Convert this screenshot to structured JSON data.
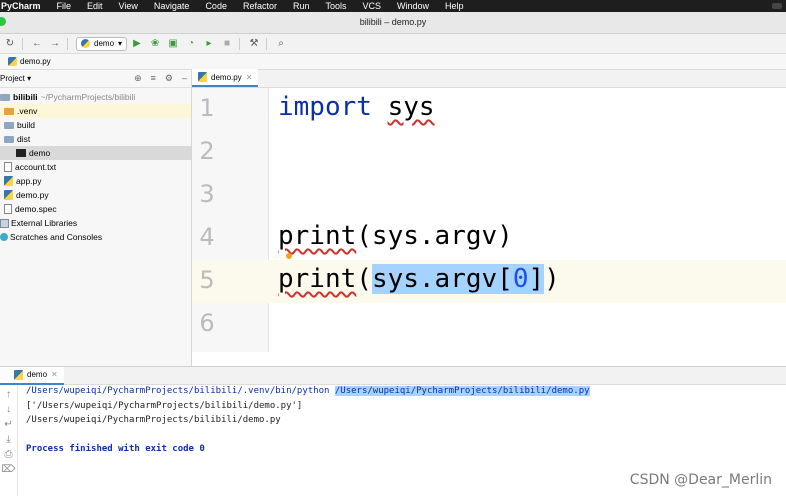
{
  "menubar": {
    "app": "PyCharm",
    "items": [
      "File",
      "Edit",
      "View",
      "Navigate",
      "Code",
      "Refactor",
      "Run",
      "Tools",
      "VCS",
      "Window",
      "Help"
    ]
  },
  "window": {
    "title": "bilibili – demo.py"
  },
  "toolbar": {
    "run_config": "demo"
  },
  "breadcrumb": {
    "file": "demo.py"
  },
  "project": {
    "header": "Project",
    "root_name": "bilibili",
    "root_path": "~/PycharmProjects/bilibili",
    "items": {
      "venv": ".venv",
      "build": "build",
      "dist": "dist",
      "demo_exe": "demo",
      "account": "account.txt",
      "app": "app.py",
      "demo_py": "demo.py",
      "demo_spec": "demo.spec",
      "ext_libs": "External Libraries",
      "scratches": "Scratches and Consoles"
    }
  },
  "editor": {
    "tab": "demo.py",
    "line_numbers": [
      "1",
      "2",
      "3",
      "4",
      "5",
      "6"
    ],
    "code": {
      "l1_kw": "import",
      "l1_mod": "sys",
      "l4_fn": "print",
      "l4_rest": "(sys.argv)",
      "l5_fn": "print",
      "l5_open": "(",
      "l5_sel_a": "sys.argv[",
      "l5_num": "0",
      "l5_sel_b": "]",
      "l5_close": ")"
    }
  },
  "run": {
    "tab": "demo",
    "cmd_prefix": "/Users/wupeiqi/PycharmProjects/bilibili/.venv/bin/python ",
    "cmd_script": "/Users/wupeiqi/PycharmProjects/bilibili/demo.py",
    "out1": "['/Users/wupeiqi/PycharmProjects/bilibili/demo.py']",
    "out2": "/Users/wupeiqi/PycharmProjects/bilibili/demo.py",
    "exit": "Process finished with exit code 0"
  },
  "watermark": "CSDN @Dear_Merlin"
}
